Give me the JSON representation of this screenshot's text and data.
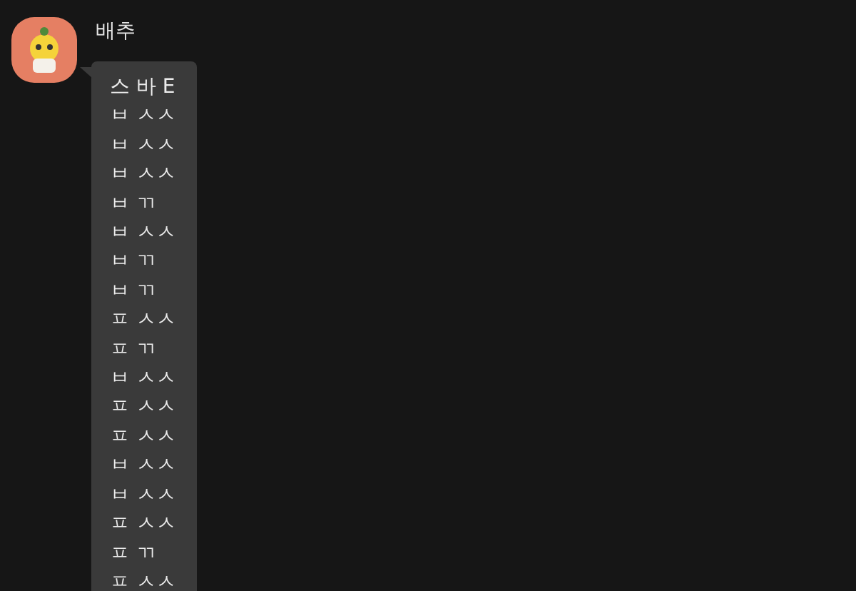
{
  "message": {
    "sender": "배추",
    "lines": [
      "스 바 E",
      "ㅂ ㅅㅅ",
      "ㅂ ㅅㅅ",
      "ㅂ ㅅㅅ",
      "ㅂ ㄲ",
      "ㅂ ㅅㅅ",
      "ㅂ ㄲ",
      "ㅂ ㄲ",
      "ㅍ ㅅㅅ",
      "ㅍ ㄲ",
      "ㅂ ㅅㅅ",
      "ㅍ ㅅㅅ",
      "ㅍ ㅅㅅ",
      "ㅂ ㅅㅅ",
      "ㅂ ㅅㅅ",
      "ㅍ ㅅㅅ",
      "ㅍ ㄲ",
      "ㅍ ㅅㅅ"
    ]
  }
}
